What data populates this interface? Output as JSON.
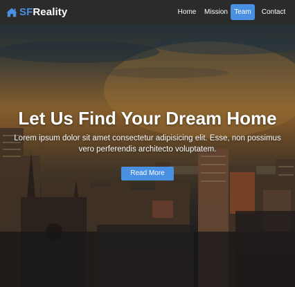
{
  "brand": {
    "name_prefix": "SF",
    "name_suffix": "Reality",
    "icon": "home-icon",
    "accent_color": "#4a90e2"
  },
  "nav": {
    "items": [
      {
        "label": "Home",
        "active": false
      },
      {
        "label": "Mission",
        "active": false
      },
      {
        "label": "Team",
        "active": true
      },
      {
        "label": "Contact",
        "active": false
      }
    ],
    "active_color": "#4a90e2",
    "background": "#2b2b2b"
  },
  "hero": {
    "title": "Let Us Find Your Dream Home",
    "subtitle": "Lorem ipsum dolor sit amet consectetur adipisicing elit. Esse, non possimus vero perferendis architecto voluptatem.",
    "button_label": "Read More",
    "background_image": "city-skyline-sunset"
  }
}
